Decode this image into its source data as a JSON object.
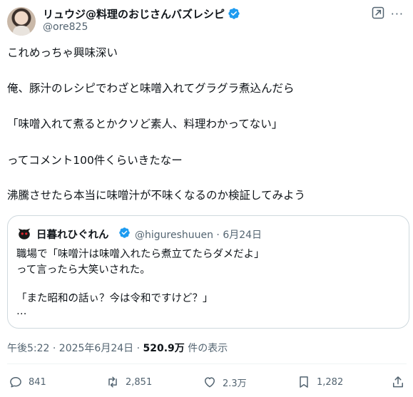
{
  "author": {
    "display_name": "リュウジ@料理のおじさんバズレシピ",
    "handle": "@ore825"
  },
  "tweet": {
    "lines": [
      "これめっちゃ興味深い",
      "俺、豚汁のレシピでわざと味噌入れてグラグラ煮込んだら",
      "「味噌入れて煮るとかクソど素人、料理わかってない」",
      "ってコメント100件くらいきたなー",
      "沸騰させたら本当に味噌汁が不味くなるのか検証してみよう"
    ]
  },
  "quote": {
    "display_name": "日暮れひぐれん",
    "meta": "@higureshuuen · 6月24日",
    "lines": [
      "職場で「味噌汁は味噌入れたら煮立てたらダメだよ」",
      "って言ったら大笑いされた。",
      "「また昭和の話ぃ？今は令和ですけど？」",
      "…"
    ]
  },
  "meta": {
    "timestamp": "午後5:22 · 2025年6月24日 · ",
    "views": "520.9万",
    "views_suffix": " 件の表示"
  },
  "actions": {
    "replies": "841",
    "reposts": "2,851",
    "likes": "2.3万",
    "bookmarks": "1,282"
  },
  "colors": {
    "verified": "#1d9bf0",
    "text": "#0f1419",
    "secondary": "#536471",
    "border": "#cfd9de"
  }
}
